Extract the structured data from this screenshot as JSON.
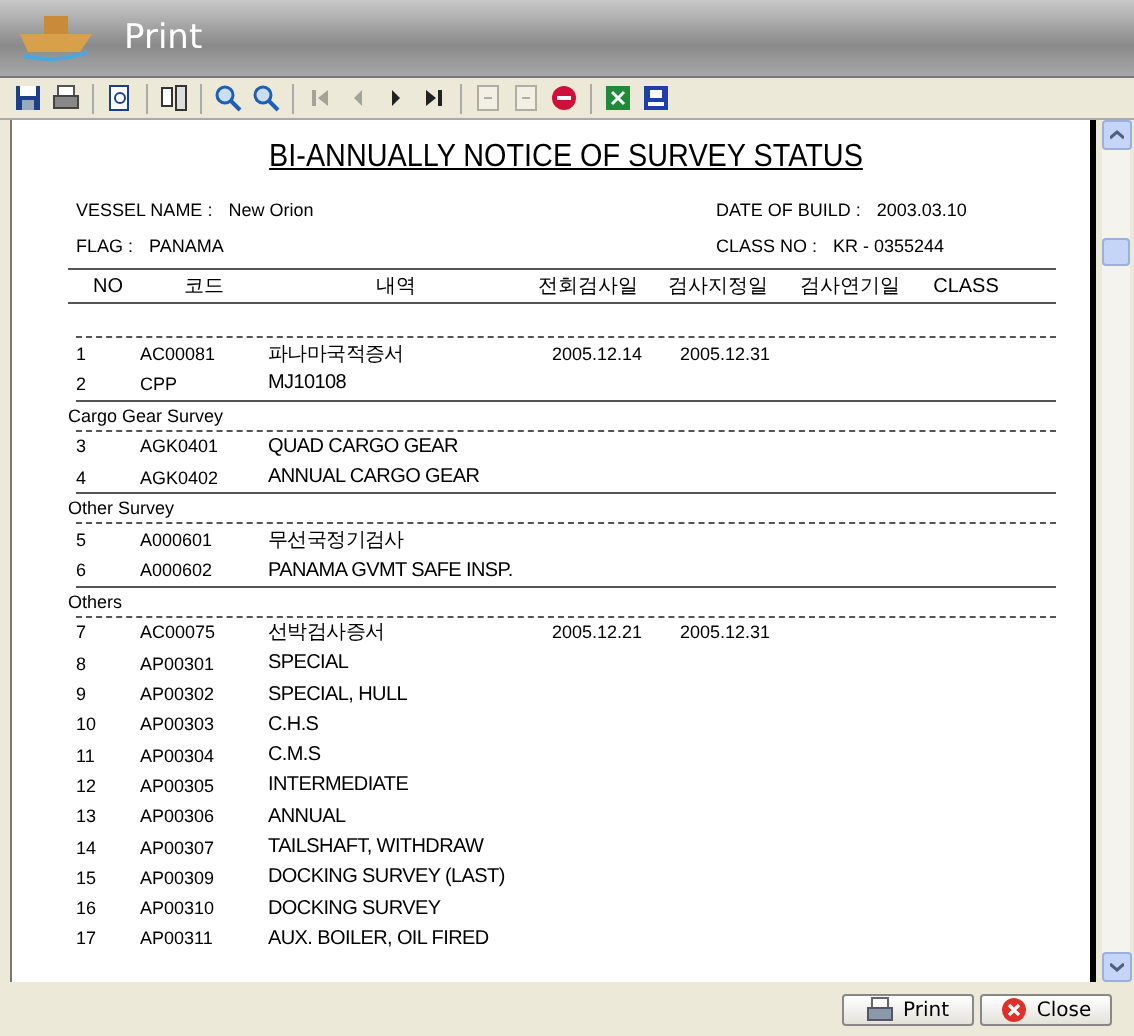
{
  "window": {
    "title": "Print"
  },
  "toolbar": [
    {
      "kind": "save",
      "disabled": false
    },
    {
      "kind": "print",
      "disabled": false
    },
    {
      "kind": "export",
      "disabled": false
    },
    {
      "kind": "setup",
      "disabled": false
    },
    {
      "kind": "zoom-in",
      "disabled": false
    },
    {
      "kind": "zoom-out",
      "disabled": false
    },
    {
      "kind": "first",
      "disabled": true
    },
    {
      "kind": "prev",
      "disabled": true
    },
    {
      "kind": "next",
      "disabled": false
    },
    {
      "kind": "last",
      "disabled": false
    },
    {
      "kind": "page-back",
      "disabled": true
    },
    {
      "kind": "page-forward",
      "disabled": true
    },
    {
      "kind": "stop",
      "disabled": false
    },
    {
      "kind": "excel",
      "disabled": false
    },
    {
      "kind": "layout",
      "disabled": false
    }
  ],
  "report": {
    "title": "BI-ANNUALLY NOTICE OF SURVEY STATUS",
    "fields": [
      {
        "label": "VESSEL NAME :",
        "value": "New Orion"
      },
      {
        "label": "DATE OF BUILD :",
        "value": "2003.03.10"
      },
      {
        "label": "FLAG :",
        "value": "PANAMA"
      },
      {
        "label": "CLASS NO :",
        "value": "KR - 0355244"
      }
    ],
    "columns": [
      "NO",
      "코드",
      "내역",
      "전회검사일",
      "검사지정일",
      "검사연기일",
      "CLASS"
    ],
    "rows": [
      {
        "kind": "item",
        "no": "1",
        "code": "AC00081",
        "desc": "파나마국적증서",
        "last": "2005.12.14",
        "due": "2005.12.31"
      },
      {
        "kind": "item",
        "no": "2",
        "code": "CPP",
        "desc": "MJ10108"
      },
      {
        "kind": "group",
        "label": "Cargo Gear Survey"
      },
      {
        "kind": "item",
        "no": "3",
        "code": "AGK0401",
        "desc": "QUAD CARGO GEAR"
      },
      {
        "kind": "item",
        "no": "4",
        "code": "AGK0402",
        "desc": "ANNUAL CARGO GEAR"
      },
      {
        "kind": "group",
        "label": "Other Survey"
      },
      {
        "kind": "item",
        "no": "5",
        "code": "A000601",
        "desc": "무선국정기검사"
      },
      {
        "kind": "item",
        "no": "6",
        "code": "A000602",
        "desc": "PANAMA GVMT SAFE INSP."
      },
      {
        "kind": "group",
        "label": "Others"
      },
      {
        "kind": "item",
        "no": "7",
        "code": "AC00075",
        "desc": "선박검사증서",
        "last": "2005.12.21",
        "due": "2005.12.31"
      },
      {
        "kind": "item",
        "no": "8",
        "code": "AP00301",
        "desc": "SPECIAL"
      },
      {
        "kind": "item",
        "no": "9",
        "code": "AP00302",
        "desc": "SPECIAL, HULL"
      },
      {
        "kind": "item",
        "no": "10",
        "code": "AP00303",
        "desc": "C.H.S"
      },
      {
        "kind": "item",
        "no": "11",
        "code": "AP00304",
        "desc": "C.M.S"
      },
      {
        "kind": "item",
        "no": "12",
        "code": "AP00305",
        "desc": "INTERMEDIATE"
      },
      {
        "kind": "item",
        "no": "13",
        "code": "AP00306",
        "desc": "ANNUAL"
      },
      {
        "kind": "item",
        "no": "14",
        "code": "AP00307",
        "desc": "TAILSHAFT, WITHDRAW"
      },
      {
        "kind": "item",
        "no": "15",
        "code": "AP00309",
        "desc": "DOCKING SURVEY (LAST)"
      },
      {
        "kind": "item",
        "no": "16",
        "code": "AP00310",
        "desc": "DOCKING SURVEY"
      },
      {
        "kind": "item",
        "no": "17",
        "code": "AP00311",
        "desc": "AUX. BOILER, OIL FIRED"
      }
    ]
  },
  "buttons": [
    {
      "kind": "print",
      "label": "Print"
    },
    {
      "kind": "close",
      "label": "Close"
    }
  ]
}
